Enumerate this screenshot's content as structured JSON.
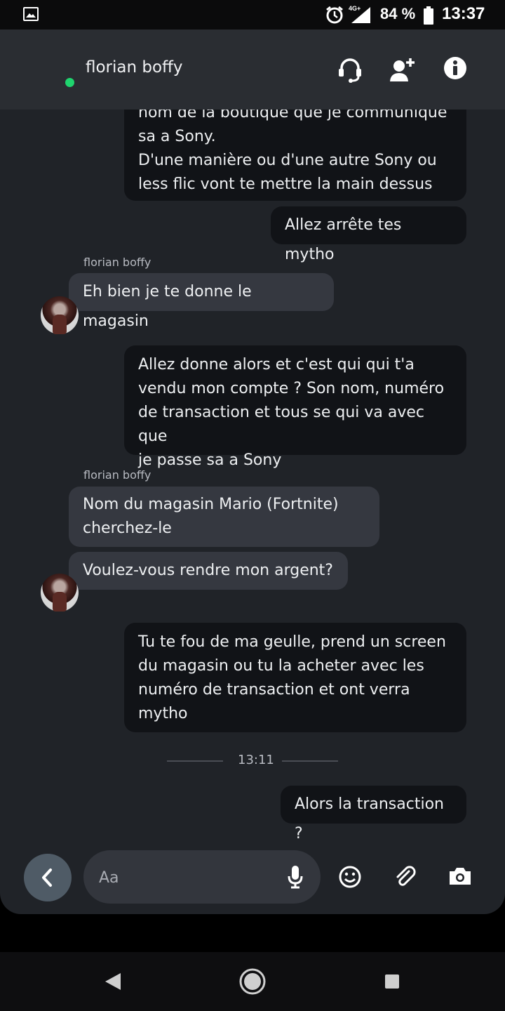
{
  "status_bar": {
    "network": "4G+",
    "battery": "84 %",
    "time": "13:37"
  },
  "header": {
    "contact_name": "florian boffy",
    "icons": [
      "headset-icon",
      "add-friend-icon",
      "info-icon"
    ]
  },
  "messages": [
    {
      "direction": "out",
      "text": "nom de la boutique que je communique\nsa a Sony.\nD'une manière ou d'une autre Sony ou\nless flic vont te mettre la main dessus"
    },
    {
      "direction": "out",
      "text": "Allez arrête tes mytho"
    },
    {
      "direction": "in",
      "sender": "florian boffy",
      "text": "Eh bien je te donne le magasin"
    },
    {
      "direction": "out",
      "text": "Allez donne alors et c'est qui qui t'a\nvendu mon compte ? Son nom, numéro\nde transaction et tous se qui va avec que\nje passe sa a Sony"
    },
    {
      "direction": "in",
      "sender": "florian boffy",
      "text": "Nom du magasin Mario (Fortnite)\ncherchez-le"
    },
    {
      "direction": "in",
      "text": "Voulez-vous rendre mon argent?"
    },
    {
      "direction": "out",
      "text": "Tu te fou de ma geulle, prend un  screen\ndu magasin ou tu la acheter avec les\nnuméro de transaction et ont verra\nmytho"
    },
    {
      "direction": "out",
      "text": "Alors la transaction ?"
    }
  ],
  "timestamp": "13:11",
  "composer": {
    "placeholder": "Aa"
  }
}
